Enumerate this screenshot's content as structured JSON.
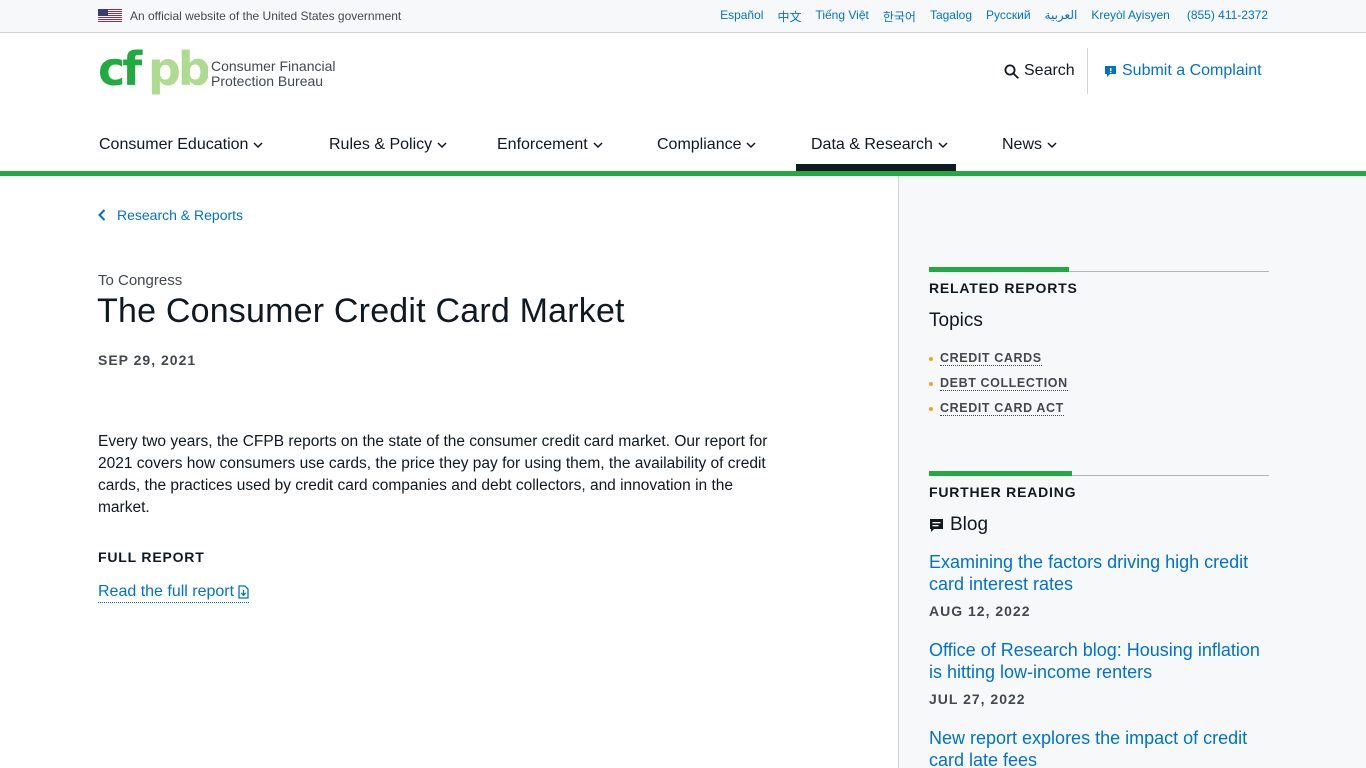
{
  "gov_banner": {
    "text": "An official website of the United States government",
    "languages": [
      "Español",
      "中文",
      "Tiếng Việt",
      "한국어",
      "Tagalog",
      "Русский",
      "العربية",
      "Kreyòl Ayisyen"
    ],
    "phone": "(855) 411-2372"
  },
  "header": {
    "logo_wordmark": "cfpb",
    "logo_line1": "Consumer Financial",
    "logo_line2": "Protection Bureau",
    "search_label": "Search",
    "complaint_label": "Submit a Complaint"
  },
  "nav": {
    "items": [
      {
        "label": "Consumer Education"
      },
      {
        "label": "Rules & Policy"
      },
      {
        "label": "Enforcement"
      },
      {
        "label": "Compliance"
      },
      {
        "label": "Data & Research"
      },
      {
        "label": "News"
      }
    ],
    "active": "Data & Research"
  },
  "main": {
    "breadcrumb": "Research & Reports",
    "category": "To Congress",
    "title": "The Consumer Credit Card Market",
    "date": "SEP 29, 2021",
    "summary": "Every two years, the CFPB reports on the state of the consumer credit card market. Our report for 2021 covers how consumers use cards, the price they pay for using them, the availability of credit cards, the practices used by credit card companies and debt collectors, and innovation in the market.",
    "full_report_label": "FULL REPORT",
    "full_report_link": "Read the full report"
  },
  "sidebar": {
    "related": {
      "heading": "RELATED REPORTS",
      "subheading": "Topics",
      "topics": [
        "CREDIT CARDS",
        "DEBT COLLECTION",
        "CREDIT CARD ACT"
      ]
    },
    "further": {
      "heading": "FURTHER READING",
      "subheading": "Blog",
      "posts": [
        {
          "title": "Examining the factors driving high credit card interest rates",
          "date": "AUG 12, 2022"
        },
        {
          "title": "Office of Research blog: Housing inflation is hitting low-income renters",
          "date": "JUL 27, 2022"
        },
        {
          "title": "New report explores the impact of credit card late fees",
          "date": ""
        }
      ]
    }
  },
  "colors": {
    "brand_green": "#20aa3f",
    "light_green": "#addc91",
    "link_blue": "#0072ce",
    "bullet_orange": "#ff9e1b"
  },
  "icons": [
    "us-flag-icon",
    "search-icon",
    "complaint-icon",
    "chevron-down-icon",
    "chevron-left-icon",
    "download-document-icon",
    "speech-bubble-icon"
  ]
}
